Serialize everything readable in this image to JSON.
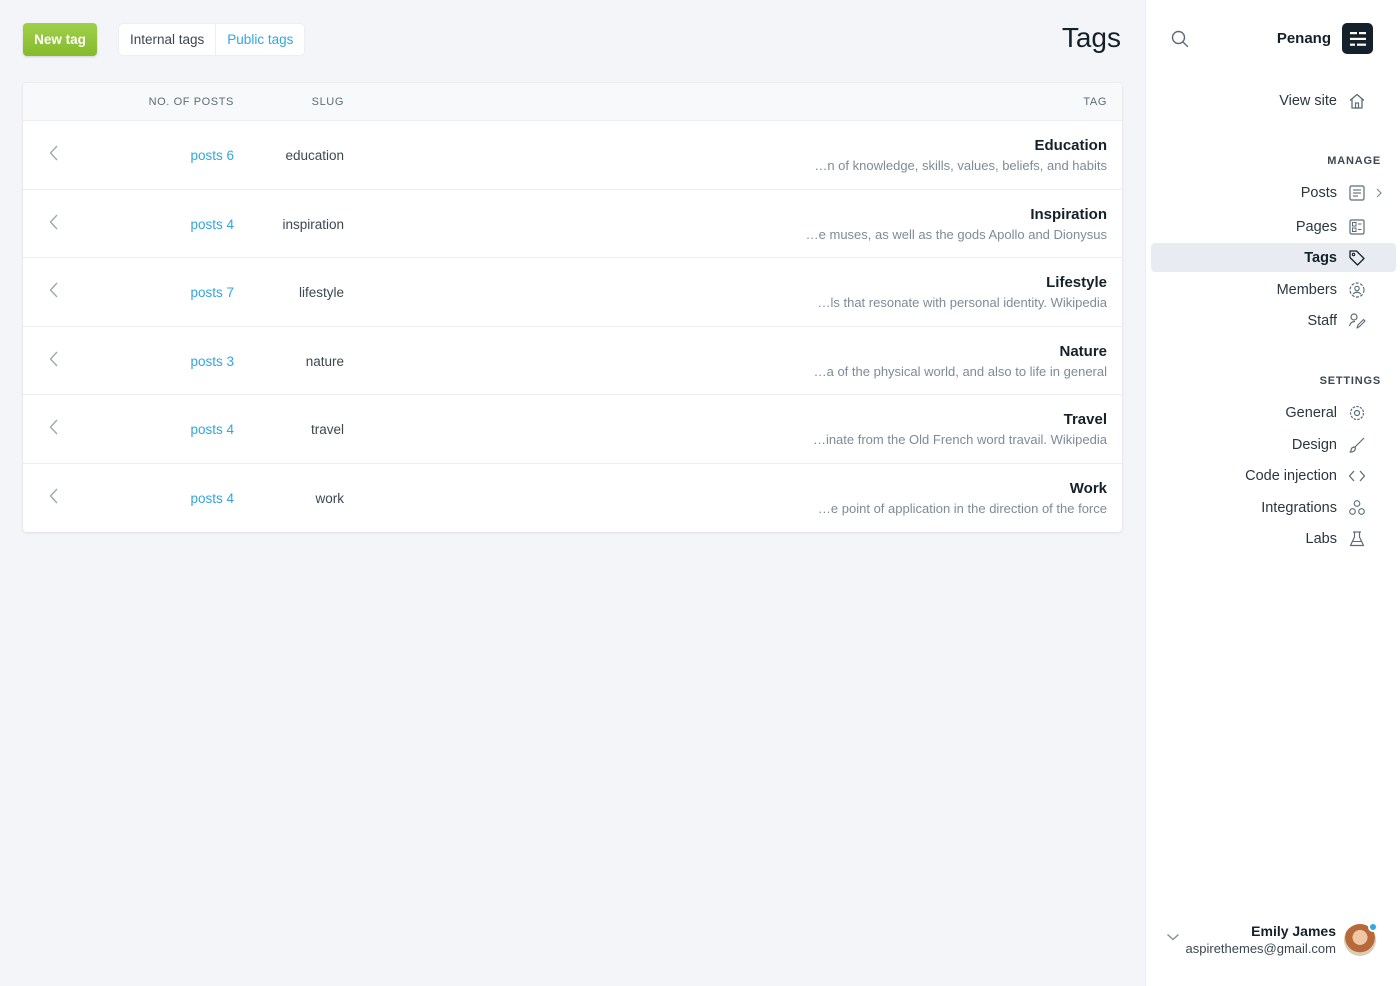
{
  "header": {
    "new_tag_label": "New tag",
    "filters": [
      {
        "label": "Internal tags",
        "active": false
      },
      {
        "label": "Public tags",
        "active": true
      }
    ],
    "title": "Tags"
  },
  "table": {
    "columns": {
      "posts": "NO. OF POSTS",
      "slug": "SLUG",
      "tag": "TAG"
    },
    "rows": [
      {
        "posts": "posts 6",
        "slug": "education",
        "name": "Education",
        "description": "…n of knowledge, skills, values, beliefs, and habits"
      },
      {
        "posts": "posts 4",
        "slug": "inspiration",
        "name": "Inspiration",
        "description": "…e muses, as well as the gods Apollo and Dionysus"
      },
      {
        "posts": "posts 7",
        "slug": "lifestyle",
        "name": "Lifestyle",
        "description": "…ls that resonate with personal identity. Wikipedia"
      },
      {
        "posts": "posts 3",
        "slug": "nature",
        "name": "Nature",
        "description": "…a of the physical world, and also to life in general"
      },
      {
        "posts": "posts 4",
        "slug": "travel",
        "name": "Travel",
        "description": "…inate from the Old French word travail. Wikipedia"
      },
      {
        "posts": "posts 4",
        "slug": "work",
        "name": "Work",
        "description": "…e point of application in the direction of the force"
      }
    ]
  },
  "sidebar": {
    "site_name": "Penang",
    "view_site": "View site",
    "manage_label": "MANAGE",
    "manage": [
      {
        "label": "Posts",
        "icon": "posts-icon"
      },
      {
        "label": "Pages",
        "icon": "pages-icon"
      },
      {
        "label": "Tags",
        "icon": "tag-icon",
        "active": true
      },
      {
        "label": "Members",
        "icon": "members-icon"
      },
      {
        "label": "Staff",
        "icon": "staff-icon"
      }
    ],
    "settings_label": "SETTINGS",
    "settings": [
      {
        "label": "General",
        "icon": "gear-icon"
      },
      {
        "label": "Design",
        "icon": "brush-icon"
      },
      {
        "label": "Code injection",
        "icon": "code-icon"
      },
      {
        "label": "Integrations",
        "icon": "integrations-icon"
      },
      {
        "label": "Labs",
        "icon": "flask-icon"
      }
    ],
    "user": {
      "name": "Emily James",
      "email": "aspirethemes@gmail.com"
    }
  },
  "colors": {
    "accent": "#2fa7e0",
    "primary_button": "#9fd04a",
    "dark": "#15212a"
  }
}
